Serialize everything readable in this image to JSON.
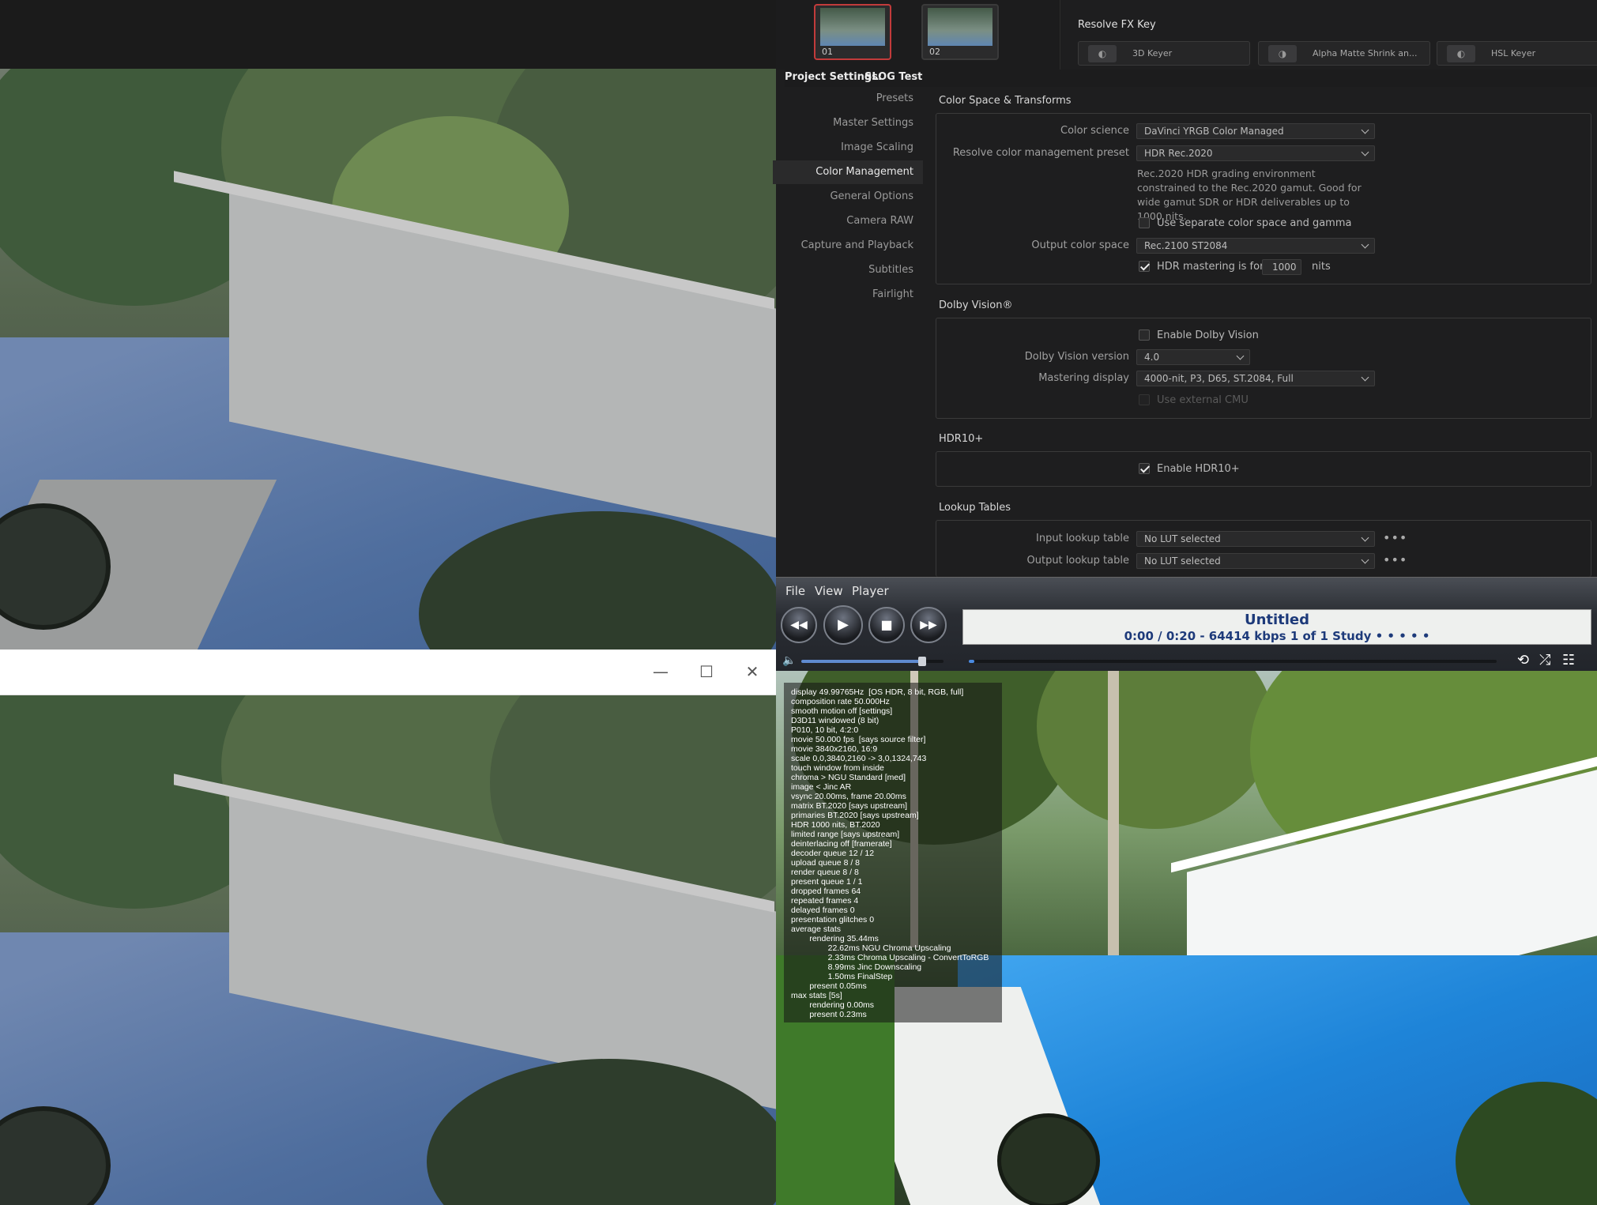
{
  "top_window": {
    "minimize": "—",
    "maximize": "☐",
    "close": "✕"
  },
  "resolve": {
    "nodes": [
      {
        "label": "01"
      },
      {
        "label": "02"
      }
    ],
    "fx_key_title": "Resolve FX Key",
    "fx_buttons": [
      {
        "label": "3D Keyer",
        "icon": "keyer-icon"
      },
      {
        "label": "Alpha Matte Shrink an...",
        "icon": "matte-icon"
      },
      {
        "label": "HSL Keyer",
        "icon": "keyer-icon"
      }
    ],
    "project_settings": {
      "title_prefix": "Project Settings:",
      "project_name": "SLOG Test",
      "nav": [
        "Presets",
        "Master Settings",
        "Image Scaling",
        "Color Management",
        "General Options",
        "Camera RAW",
        "Capture and Playback",
        "Subtitles",
        "Fairlight"
      ],
      "nav_selected": "Color Management",
      "color_space": {
        "title": "Color Space & Transforms",
        "color_science_label": "Color science",
        "color_science_value": "DaVinci YRGB Color Managed",
        "preset_label": "Resolve color management preset",
        "preset_value": "HDR Rec.2020",
        "preset_desc": "Rec.2020 HDR grading environment constrained to the Rec.2020 gamut. Good for wide gamut SDR or HDR deliverables up to 1000 nits.",
        "separate_label": "Use separate color space and gamma",
        "output_label": "Output color space",
        "output_value": "Rec.2100 ST2084",
        "hdr_mastering_label": "HDR mastering is for",
        "hdr_mastering_value": "1000",
        "nits": "nits"
      },
      "dolby": {
        "title": "Dolby Vision®",
        "enable_label": "Enable Dolby Vision",
        "version_label": "Dolby Vision version",
        "version_value": "4.0",
        "mastering_label": "Mastering display",
        "mastering_value": "4000-nit, P3, D65, ST.2084, Full",
        "external_cmu": "Use external CMU"
      },
      "hdr10": {
        "title": "HDR10+",
        "enable_label": "Enable HDR10+"
      },
      "lut": {
        "title": "Lookup Tables",
        "input_label": "Input lookup table",
        "input_value": "No LUT selected",
        "output_label": "Output lookup table",
        "output_value": "No LUT selected",
        "more": "•••"
      }
    }
  },
  "player": {
    "menu": [
      "File",
      "View",
      "Player"
    ],
    "buttons": {
      "rewind": "◀◀",
      "play": "▶",
      "stop": "■",
      "forward": "▶▶"
    },
    "title": "Untitled",
    "info": "0:00 / 0:20 - 64414 kbps   1 of 1  Study   • • • • •",
    "volume_icon": "speaker-icon",
    "volume_level": 0.85,
    "progress": 0.01,
    "right_icons": [
      "repeat-icon",
      "shuffle-icon",
      "equalizer-icon"
    ]
  },
  "osd_lines": [
    "display 49.99765Hz  [OS HDR, 8 bit, RGB, full]",
    "composition rate 50.000Hz",
    "smooth motion off [settings]",
    "D3D11 windowed (8 bit)",
    "P010, 10 bit, 4:2:0",
    "movie 50.000 fps  [says source filter]",
    "movie 3840x2160, 16:9",
    "scale 0,0,3840,2160 -> 3,0,1324,743",
    "touch window from inside",
    "chroma > NGU Standard [med]",
    "image < Jinc AR",
    "vsync 20.00ms, frame 20.00ms",
    "matrix BT.2020 [says upstream]",
    "primaries BT.2020 [says upstream]",
    "HDR 1000 nits, BT.2020",
    "limited range [says upstream]",
    "deinterlacing off [framerate]",
    "decoder queue 12 / 12",
    "upload queue 8 / 8",
    "render queue 8 / 8",
    "present queue 1 / 1",
    "dropped frames 64",
    "repeated frames 4",
    "delayed frames 0",
    "presentation glitches 0",
    "average stats",
    "        rendering 35.44ms",
    "                22.62ms NGU Chroma Upscaling",
    "                2.33ms Chroma Upscaling - ConvertToRGB",
    "                8.99ms Jinc Downscaling",
    "                1.50ms FinalStep",
    "        present 0.05ms",
    "max stats [5s]",
    "        rendering 0.00ms",
    "        present 0.23ms"
  ]
}
